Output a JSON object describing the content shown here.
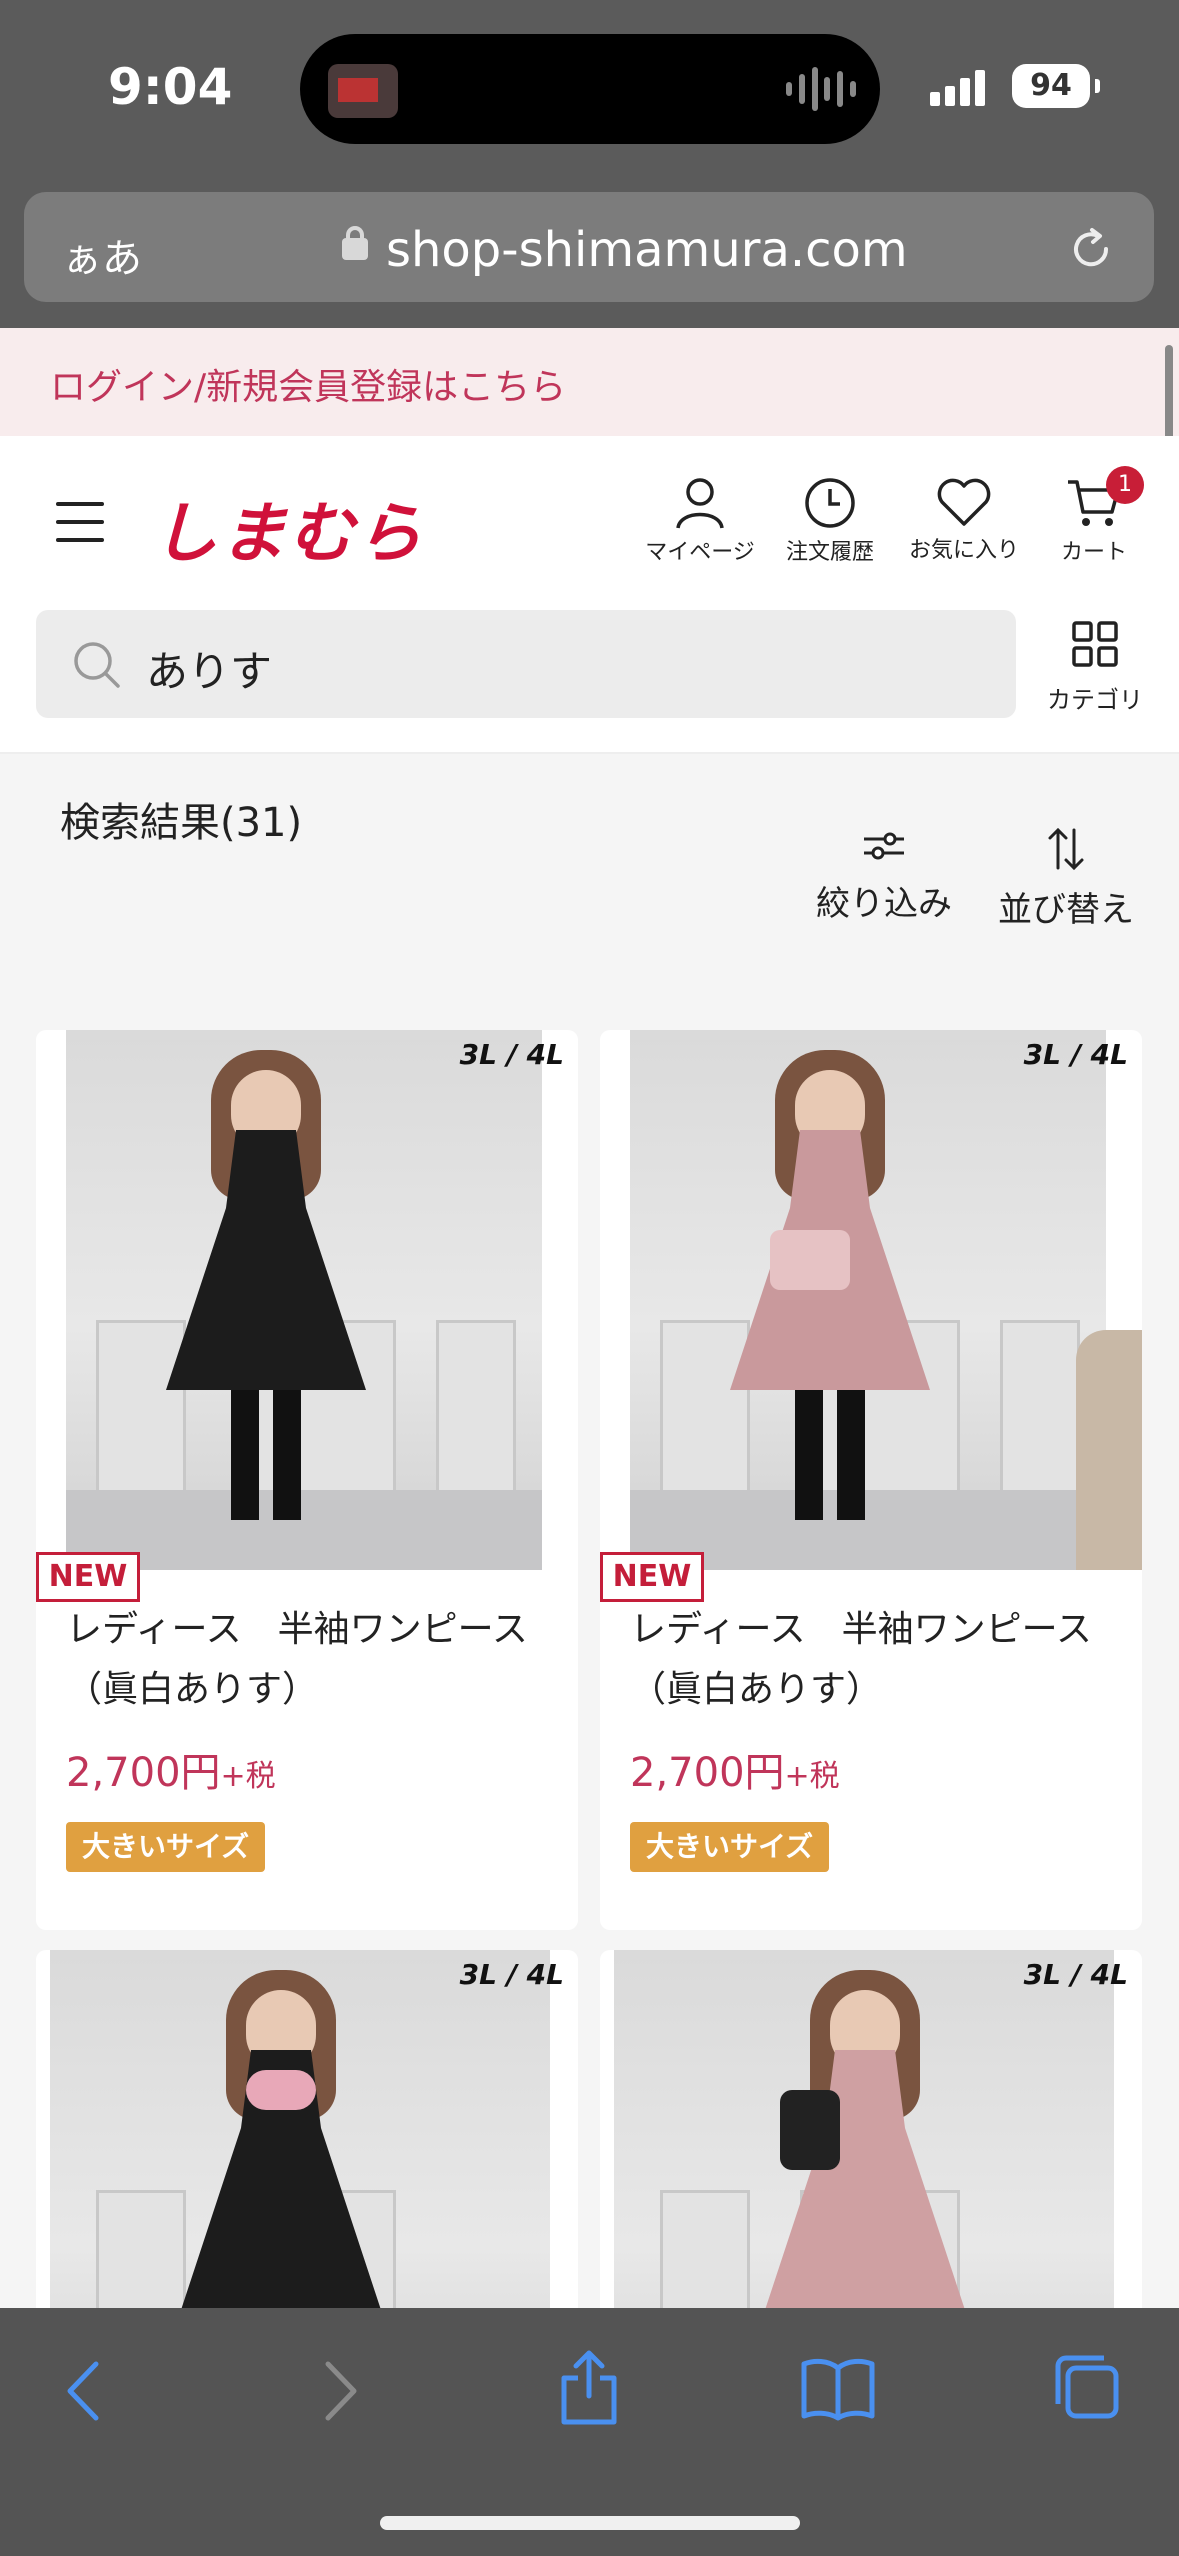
{
  "status_bar": {
    "time": "9:04",
    "battery": "94"
  },
  "browser": {
    "aa_label": "ぁあ",
    "url": "shop-shimamura.com"
  },
  "login_banner": {
    "text": "ログイン/新規会員登録はこちら"
  },
  "header": {
    "logo": "しまむら",
    "icons": [
      {
        "name": "mypage",
        "label": "マイページ",
        "icon": "person-icon"
      },
      {
        "name": "order-history",
        "label": "注文履歴",
        "icon": "clock-icon"
      },
      {
        "name": "favorites",
        "label": "お気に入り",
        "icon": "heart-icon"
      },
      {
        "name": "cart",
        "label": "カート",
        "icon": "cart-icon"
      }
    ],
    "cart_count": "1",
    "category_label": "カテゴリ"
  },
  "search": {
    "value": "ありす"
  },
  "results": {
    "count_label": "検索結果(31)",
    "filter_label": "絞り込み",
    "sort_label": "並び替え"
  },
  "products": [
    {
      "size_tag": "3L / 4L",
      "badge": "NEW",
      "name": "レディース　半袖ワンピース（眞白ありす）",
      "price": "2,700円",
      "tax": "+税",
      "tag": "大きいサイズ",
      "dress_color": "#1c1c1c"
    },
    {
      "size_tag": "3L / 4L",
      "badge": "NEW",
      "name": "レディース　半袖ワンピース（眞白ありす）",
      "price": "2,700円",
      "tax": "+税",
      "tag": "大きいサイズ",
      "dress_color": "#c9999c"
    },
    {
      "size_tag": "3L / 4L",
      "dress_color": "#1c1c1c"
    },
    {
      "size_tag": "3L / 4L",
      "dress_color": "#cfa0a2"
    }
  ],
  "colors": {
    "brand_red": "#d0113a",
    "price_pink": "#c0355a",
    "tag_orange": "#e0a040"
  }
}
